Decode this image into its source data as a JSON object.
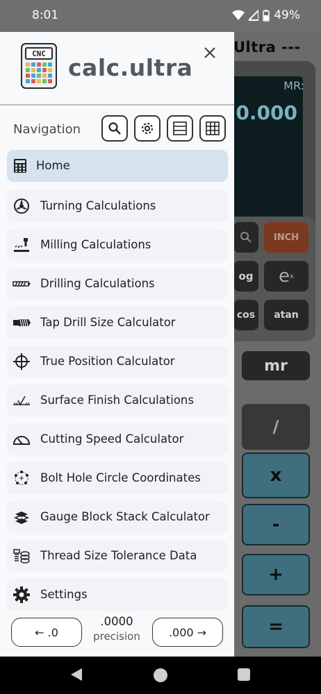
{
  "status_bar": {
    "time": "8:01",
    "battery": "49%"
  },
  "background_calculator": {
    "title": "Ultra ---",
    "mr_label": "MR:",
    "display_value": "0.000",
    "keys": {
      "unit_toggle": "INCH",
      "exp": "e",
      "exp_sup": "x",
      "log_partial": "og",
      "cos_partial": "cos",
      "atan": "atan",
      "mr": "mr",
      "divide": "/",
      "multiply": "x",
      "subtract": "-",
      "add": "+",
      "equals": "="
    }
  },
  "drawer": {
    "app_name": "calc.ultra",
    "logo_text": "CNC",
    "heading": "Navigation",
    "menu_items": [
      {
        "label": "Home",
        "icon": "calculator-icon",
        "active": true
      },
      {
        "label": "Turning Calculations",
        "icon": "lathe-chuck-icon"
      },
      {
        "label": "Milling Calculations",
        "icon": "milling-icon"
      },
      {
        "label": "Drilling Calculations",
        "icon": "drill-bit-icon"
      },
      {
        "label": "Tap Drill Size Calculator",
        "icon": "tap-icon"
      },
      {
        "label": "True Position Calculator",
        "icon": "crosshair-icon"
      },
      {
        "label": "Surface Finish Calculations",
        "icon": "surface-finish-icon"
      },
      {
        "label": "Cutting Speed Calculator",
        "icon": "speedometer-icon"
      },
      {
        "label": "Bolt Hole Circle Coordinates",
        "icon": "bolt-circle-icon"
      },
      {
        "label": "Gauge Block Stack Calculator",
        "icon": "gauge-block-icon"
      },
      {
        "label": "Thread Size Tolerance Data",
        "icon": "thread-icon"
      },
      {
        "label": "Settings",
        "icon": "gear-icon"
      }
    ],
    "precision": {
      "decrease_label": "← .0",
      "value": ".0000",
      "label": "precision",
      "increase_label": ".000 →"
    }
  },
  "colors": {
    "active_item": "#d4e3ee",
    "app_name": "#4f5b61",
    "calc_blue_key": "#3f6f7f",
    "calc_orange_key": "#7b3a1f"
  }
}
